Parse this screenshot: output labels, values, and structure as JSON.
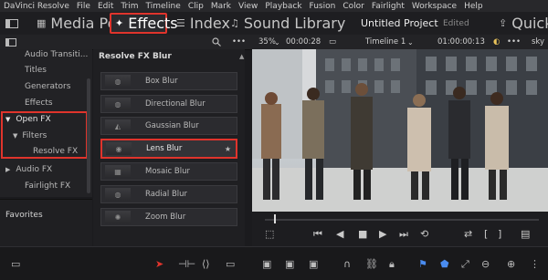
{
  "menu": [
    "DaVinci Resolve",
    "File",
    "Edit",
    "Trim",
    "Timeline",
    "Clip",
    "Mark",
    "View",
    "Playback",
    "Fusion",
    "Color",
    "Fairlight",
    "Workspace",
    "Help"
  ],
  "toolbar": {
    "media_pool": "Media Pool",
    "effects": "Effects",
    "index": "Index",
    "sound_library": "Sound Library",
    "project_title": "Untitled Project",
    "edited": "Edited",
    "quick_export": "Quick Ex"
  },
  "viewer_bar": {
    "zoom": "35%",
    "source_tc": "00:00:28",
    "timeline_name": "Timeline 1",
    "record_tc": "01:00:00:13",
    "clip_name": "sky"
  },
  "left_panel": {
    "items": [
      "Audio Transiti...",
      "Titles",
      "Generators",
      "Effects",
      "Open FX",
      "Filters",
      "Resolve FX",
      "Audio FX",
      "Fairlight FX"
    ],
    "favorites": "Favorites"
  },
  "fx_panel": {
    "header": "Resolve FX Blur",
    "items": [
      "Box Blur",
      "Directional Blur",
      "Gaussian Blur",
      "Lens Blur",
      "Mosaic Blur",
      "Radial Blur",
      "Zoom Blur"
    ]
  },
  "accent_color": "#e0342c"
}
